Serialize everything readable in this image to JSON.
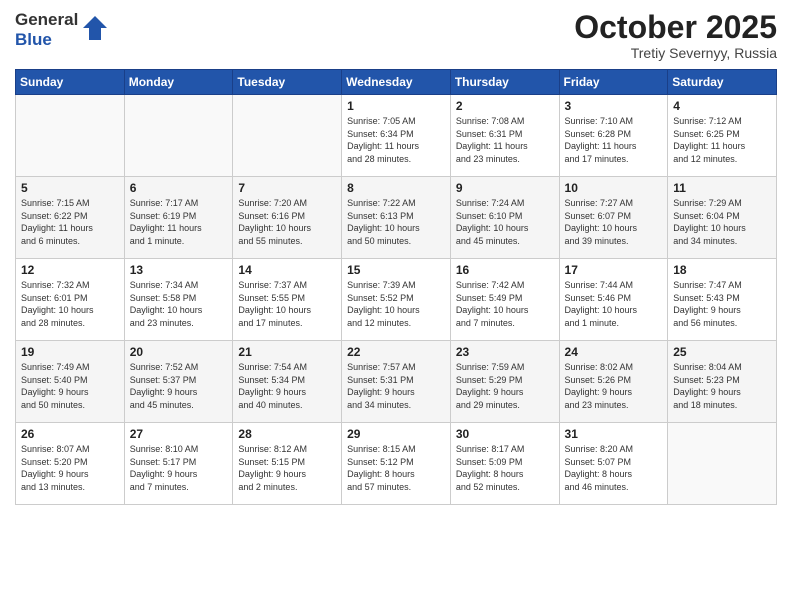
{
  "header": {
    "logo_line1": "General",
    "logo_line2": "Blue",
    "month": "October 2025",
    "location": "Tretiy Severnyy, Russia"
  },
  "weekdays": [
    "Sunday",
    "Monday",
    "Tuesday",
    "Wednesday",
    "Thursday",
    "Friday",
    "Saturday"
  ],
  "weeks": [
    [
      {
        "day": "",
        "info": ""
      },
      {
        "day": "",
        "info": ""
      },
      {
        "day": "",
        "info": ""
      },
      {
        "day": "1",
        "info": "Sunrise: 7:05 AM\nSunset: 6:34 PM\nDaylight: 11 hours\nand 28 minutes."
      },
      {
        "day": "2",
        "info": "Sunrise: 7:08 AM\nSunset: 6:31 PM\nDaylight: 11 hours\nand 23 minutes."
      },
      {
        "day": "3",
        "info": "Sunrise: 7:10 AM\nSunset: 6:28 PM\nDaylight: 11 hours\nand 17 minutes."
      },
      {
        "day": "4",
        "info": "Sunrise: 7:12 AM\nSunset: 6:25 PM\nDaylight: 11 hours\nand 12 minutes."
      }
    ],
    [
      {
        "day": "5",
        "info": "Sunrise: 7:15 AM\nSunset: 6:22 PM\nDaylight: 11 hours\nand 6 minutes."
      },
      {
        "day": "6",
        "info": "Sunrise: 7:17 AM\nSunset: 6:19 PM\nDaylight: 11 hours\nand 1 minute."
      },
      {
        "day": "7",
        "info": "Sunrise: 7:20 AM\nSunset: 6:16 PM\nDaylight: 10 hours\nand 55 minutes."
      },
      {
        "day": "8",
        "info": "Sunrise: 7:22 AM\nSunset: 6:13 PM\nDaylight: 10 hours\nand 50 minutes."
      },
      {
        "day": "9",
        "info": "Sunrise: 7:24 AM\nSunset: 6:10 PM\nDaylight: 10 hours\nand 45 minutes."
      },
      {
        "day": "10",
        "info": "Sunrise: 7:27 AM\nSunset: 6:07 PM\nDaylight: 10 hours\nand 39 minutes."
      },
      {
        "day": "11",
        "info": "Sunrise: 7:29 AM\nSunset: 6:04 PM\nDaylight: 10 hours\nand 34 minutes."
      }
    ],
    [
      {
        "day": "12",
        "info": "Sunrise: 7:32 AM\nSunset: 6:01 PM\nDaylight: 10 hours\nand 28 minutes."
      },
      {
        "day": "13",
        "info": "Sunrise: 7:34 AM\nSunset: 5:58 PM\nDaylight: 10 hours\nand 23 minutes."
      },
      {
        "day": "14",
        "info": "Sunrise: 7:37 AM\nSunset: 5:55 PM\nDaylight: 10 hours\nand 17 minutes."
      },
      {
        "day": "15",
        "info": "Sunrise: 7:39 AM\nSunset: 5:52 PM\nDaylight: 10 hours\nand 12 minutes."
      },
      {
        "day": "16",
        "info": "Sunrise: 7:42 AM\nSunset: 5:49 PM\nDaylight: 10 hours\nand 7 minutes."
      },
      {
        "day": "17",
        "info": "Sunrise: 7:44 AM\nSunset: 5:46 PM\nDaylight: 10 hours\nand 1 minute."
      },
      {
        "day": "18",
        "info": "Sunrise: 7:47 AM\nSunset: 5:43 PM\nDaylight: 9 hours\nand 56 minutes."
      }
    ],
    [
      {
        "day": "19",
        "info": "Sunrise: 7:49 AM\nSunset: 5:40 PM\nDaylight: 9 hours\nand 50 minutes."
      },
      {
        "day": "20",
        "info": "Sunrise: 7:52 AM\nSunset: 5:37 PM\nDaylight: 9 hours\nand 45 minutes."
      },
      {
        "day": "21",
        "info": "Sunrise: 7:54 AM\nSunset: 5:34 PM\nDaylight: 9 hours\nand 40 minutes."
      },
      {
        "day": "22",
        "info": "Sunrise: 7:57 AM\nSunset: 5:31 PM\nDaylight: 9 hours\nand 34 minutes."
      },
      {
        "day": "23",
        "info": "Sunrise: 7:59 AM\nSunset: 5:29 PM\nDaylight: 9 hours\nand 29 minutes."
      },
      {
        "day": "24",
        "info": "Sunrise: 8:02 AM\nSunset: 5:26 PM\nDaylight: 9 hours\nand 23 minutes."
      },
      {
        "day": "25",
        "info": "Sunrise: 8:04 AM\nSunset: 5:23 PM\nDaylight: 9 hours\nand 18 minutes."
      }
    ],
    [
      {
        "day": "26",
        "info": "Sunrise: 8:07 AM\nSunset: 5:20 PM\nDaylight: 9 hours\nand 13 minutes."
      },
      {
        "day": "27",
        "info": "Sunrise: 8:10 AM\nSunset: 5:17 PM\nDaylight: 9 hours\nand 7 minutes."
      },
      {
        "day": "28",
        "info": "Sunrise: 8:12 AM\nSunset: 5:15 PM\nDaylight: 9 hours\nand 2 minutes."
      },
      {
        "day": "29",
        "info": "Sunrise: 8:15 AM\nSunset: 5:12 PM\nDaylight: 8 hours\nand 57 minutes."
      },
      {
        "day": "30",
        "info": "Sunrise: 8:17 AM\nSunset: 5:09 PM\nDaylight: 8 hours\nand 52 minutes."
      },
      {
        "day": "31",
        "info": "Sunrise: 8:20 AM\nSunset: 5:07 PM\nDaylight: 8 hours\nand 46 minutes."
      },
      {
        "day": "",
        "info": ""
      }
    ]
  ]
}
